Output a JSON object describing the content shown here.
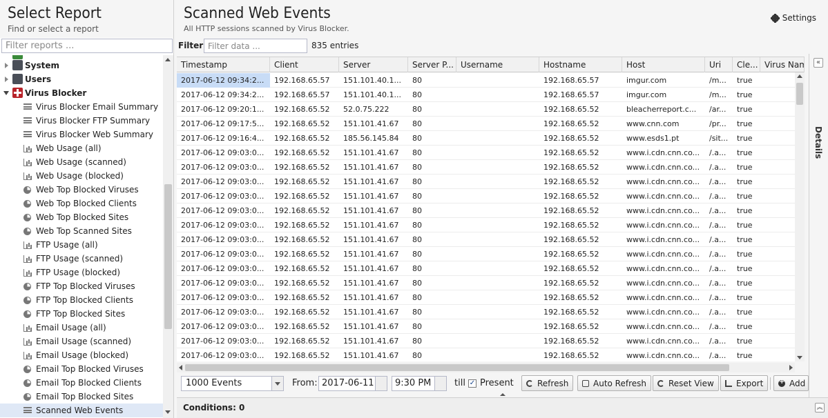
{
  "left_panel": {
    "title": "Select Report",
    "subtitle": "Find or select a report",
    "filter_placeholder": "Filter reports ..."
  },
  "tree": {
    "categories": [
      {
        "label": "System",
        "icon": "system-icon"
      },
      {
        "label": "Users",
        "icon": "users-icon"
      },
      {
        "label": "Virus Blocker",
        "icon": "virus-blocker-icon"
      }
    ],
    "reports": [
      {
        "label": "Virus Blocker Email Summary",
        "icon": "text-report-icon"
      },
      {
        "label": "Virus Blocker FTP Summary",
        "icon": "text-report-icon"
      },
      {
        "label": "Virus Blocker Web Summary",
        "icon": "text-report-icon"
      },
      {
        "label": "Web Usage (all)",
        "icon": "bar-chart-icon"
      },
      {
        "label": "Web Usage (scanned)",
        "icon": "bar-chart-icon"
      },
      {
        "label": "Web Usage (blocked)",
        "icon": "bar-chart-icon"
      },
      {
        "label": "Web Top Blocked Viruses",
        "icon": "pie-chart-icon"
      },
      {
        "label": "Web Top Blocked Clients",
        "icon": "pie-chart-icon"
      },
      {
        "label": "Web Top Blocked Sites",
        "icon": "pie-chart-icon"
      },
      {
        "label": "Web Top Scanned Sites",
        "icon": "pie-chart-icon"
      },
      {
        "label": "FTP Usage (all)",
        "icon": "bar-chart-icon"
      },
      {
        "label": "FTP Usage (scanned)",
        "icon": "bar-chart-icon"
      },
      {
        "label": "FTP Usage (blocked)",
        "icon": "bar-chart-icon"
      },
      {
        "label": "FTP Top Blocked Viruses",
        "icon": "pie-chart-icon"
      },
      {
        "label": "FTP Top Blocked Clients",
        "icon": "pie-chart-icon"
      },
      {
        "label": "FTP Top Blocked Sites",
        "icon": "pie-chart-icon"
      },
      {
        "label": "Email Usage (all)",
        "icon": "bar-chart-icon"
      },
      {
        "label": "Email Usage (scanned)",
        "icon": "bar-chart-icon"
      },
      {
        "label": "Email Usage (blocked)",
        "icon": "bar-chart-icon"
      },
      {
        "label": "Email Top Blocked Viruses",
        "icon": "pie-chart-icon"
      },
      {
        "label": "Email Top Blocked Clients",
        "icon": "pie-chart-icon"
      },
      {
        "label": "Email Top Blocked Sites",
        "icon": "pie-chart-icon"
      },
      {
        "label": "Scanned Web Events",
        "icon": "event-list-icon",
        "selected": true
      }
    ]
  },
  "main": {
    "title": "Scanned Web Events",
    "subtitle": "All HTTP sessions scanned by Virus Blocker.",
    "settings_label": "Settings",
    "filter_label": "Filter:",
    "filter_placeholder": "Filter data ...",
    "entries": "835 entries"
  },
  "grid": {
    "columns": [
      "Timestamp",
      "Client",
      "Server",
      "Server P...",
      "Username",
      "Hostname",
      "Host",
      "Uri",
      "Cle...",
      "Virus Nam"
    ],
    "rows": [
      [
        "2017-06-12 09:34:2...",
        "192.168.65.57",
        "151.101.40.1...",
        "80",
        "",
        "192.168.65.57",
        "imgur.com",
        "/m...",
        "true",
        ""
      ],
      [
        "2017-06-12 09:34:2...",
        "192.168.65.57",
        "151.101.40.1...",
        "80",
        "",
        "192.168.65.57",
        "imgur.com",
        "/m...",
        "true",
        ""
      ],
      [
        "2017-06-12 09:20:1...",
        "192.168.65.52",
        "52.0.75.222",
        "80",
        "",
        "192.168.65.52",
        "bleacherreport.c...",
        "/ar...",
        "true",
        ""
      ],
      [
        "2017-06-12 09:17:5...",
        "192.168.65.52",
        "151.101.41.67",
        "80",
        "",
        "192.168.65.52",
        "www.cnn.com",
        "/pr...",
        "true",
        ""
      ],
      [
        "2017-06-12 09:16:4...",
        "192.168.65.52",
        "185.56.145.84",
        "80",
        "",
        "192.168.65.52",
        "www.esds1.pt",
        "/sit...",
        "true",
        ""
      ],
      [
        "2017-06-12 09:03:0...",
        "192.168.65.52",
        "151.101.41.67",
        "80",
        "",
        "192.168.65.52",
        "www.i.cdn.cnn.co...",
        "/.a...",
        "true",
        ""
      ],
      [
        "2017-06-12 09:03:0...",
        "192.168.65.52",
        "151.101.41.67",
        "80",
        "",
        "192.168.65.52",
        "www.i.cdn.cnn.co...",
        "/.a...",
        "true",
        ""
      ],
      [
        "2017-06-12 09:03:0...",
        "192.168.65.52",
        "151.101.41.67",
        "80",
        "",
        "192.168.65.52",
        "www.i.cdn.cnn.co...",
        "/.a...",
        "true",
        ""
      ],
      [
        "2017-06-12 09:03:0...",
        "192.168.65.52",
        "151.101.41.67",
        "80",
        "",
        "192.168.65.52",
        "www.i.cdn.cnn.co...",
        "/.a...",
        "true",
        ""
      ],
      [
        "2017-06-12 09:03:0...",
        "192.168.65.52",
        "151.101.41.67",
        "80",
        "",
        "192.168.65.52",
        "www.i.cdn.cnn.co...",
        "/.a...",
        "true",
        ""
      ],
      [
        "2017-06-12 09:03:0...",
        "192.168.65.52",
        "151.101.41.67",
        "80",
        "",
        "192.168.65.52",
        "www.i.cdn.cnn.co...",
        "/.a...",
        "true",
        ""
      ],
      [
        "2017-06-12 09:03:0...",
        "192.168.65.52",
        "151.101.41.67",
        "80",
        "",
        "192.168.65.52",
        "www.i.cdn.cnn.co...",
        "/.a...",
        "true",
        ""
      ],
      [
        "2017-06-12 09:03:0...",
        "192.168.65.52",
        "151.101.41.67",
        "80",
        "",
        "192.168.65.52",
        "www.i.cdn.cnn.co...",
        "/.a...",
        "true",
        ""
      ],
      [
        "2017-06-12 09:03:0...",
        "192.168.65.52",
        "151.101.41.67",
        "80",
        "",
        "192.168.65.52",
        "www.i.cdn.cnn.co...",
        "/.a...",
        "true",
        ""
      ],
      [
        "2017-06-12 09:03:0...",
        "192.168.65.52",
        "151.101.41.67",
        "80",
        "",
        "192.168.65.52",
        "www.i.cdn.cnn.co...",
        "/.a...",
        "true",
        ""
      ],
      [
        "2017-06-12 09:03:0...",
        "192.168.65.52",
        "151.101.41.67",
        "80",
        "",
        "192.168.65.52",
        "www.i.cdn.cnn.co...",
        "/.a...",
        "true",
        ""
      ],
      [
        "2017-06-12 09:03:0...",
        "192.168.65.52",
        "151.101.41.67",
        "80",
        "",
        "192.168.65.52",
        "www.i.cdn.cnn.co...",
        "/.a...",
        "true",
        ""
      ],
      [
        "2017-06-12 09:03:0...",
        "192.168.65.52",
        "151.101.41.67",
        "80",
        "",
        "192.168.65.52",
        "www.i.cdn.cnn.co...",
        "/.a...",
        "true",
        ""
      ],
      [
        "2017-06-12 09:03:0...",
        "192.168.65.52",
        "151.101.41.67",
        "80",
        "",
        "192.168.65.52",
        "www.i.cdn.cnn.co...",
        "/.a...",
        "true",
        ""
      ],
      [
        "2017-06-12 09:03:0...",
        "192.168.65.52",
        "151.101.41.67",
        "80",
        "",
        "192.168.65.52",
        "www.i.cdn.cnn.co...",
        "/.a...",
        "true",
        ""
      ]
    ]
  },
  "details": {
    "label": "Details"
  },
  "toolbar": {
    "events_select": "1000 Events",
    "from_label": "From:",
    "from_date": "2017-06-11",
    "from_time": "9:30 PM",
    "till_label": "till",
    "present_label": "Present",
    "present_checked": "✓",
    "refresh_label": "Refresh",
    "auto_refresh_label": "Auto Refresh",
    "reset_view_label": "Reset View",
    "export_label": "Export",
    "add_to_dashboard_label": "Add to Da"
  },
  "conditions": {
    "label": "Conditions: 0"
  },
  "colors": {
    "selected_row": "#dfe8f6",
    "selected_cell": "#c8dcf6",
    "virus_blocker_red": "#b8232a"
  }
}
